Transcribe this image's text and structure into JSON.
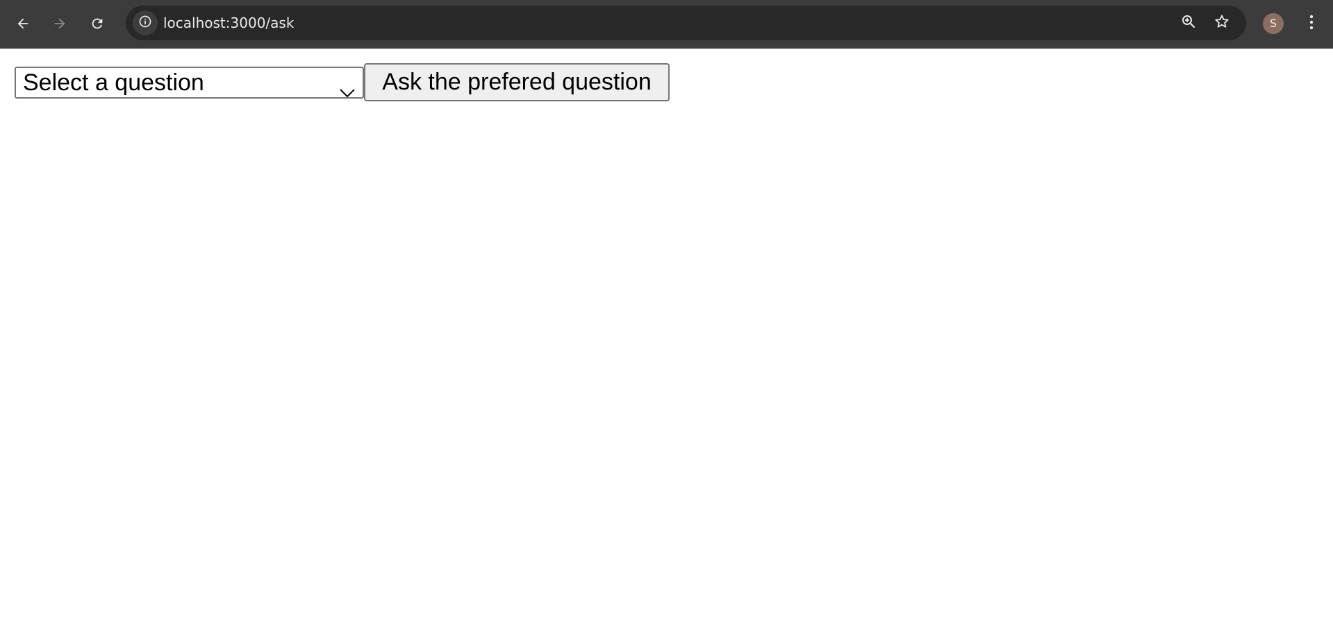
{
  "browser": {
    "url": "localhost:3000/ask",
    "profile_initial": "S",
    "icons": {
      "back": "arrow-left-icon",
      "forward": "arrow-right-icon",
      "reload": "reload-icon",
      "site_info": "info-icon",
      "zoom": "zoom-in-icon",
      "bookmark": "star-icon",
      "menu": "kebab-menu-icon"
    },
    "colors": {
      "toolbar": "#3c3c3c",
      "omnibox": "#282828",
      "avatar": "#8d6e63"
    }
  },
  "page": {
    "select": {
      "selected_value": "Select a question"
    },
    "ask_button": {
      "label": "Ask the prefered question"
    }
  }
}
